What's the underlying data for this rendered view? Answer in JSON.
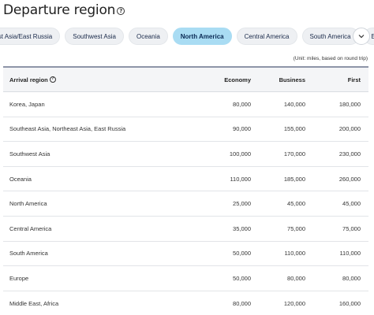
{
  "header": {
    "title": "Departure region",
    "help_icon": "question-circle-icon"
  },
  "tabs": [
    {
      "label": "East Asia/East Russia",
      "active": false
    },
    {
      "label": "Southwest Asia",
      "active": false
    },
    {
      "label": "Oceania",
      "active": false
    },
    {
      "label": "North America",
      "active": true
    },
    {
      "label": "Central America",
      "active": false
    },
    {
      "label": "South America",
      "active": false
    },
    {
      "label": "Europe",
      "active": false
    }
  ],
  "tabs_next_icon": "chevron-down-icon",
  "unit_note": "(Unit: miles, based on round trip)",
  "table": {
    "headers": {
      "region": "Arrival region",
      "economy": "Economy",
      "business": "Business",
      "first": "First"
    },
    "rows": [
      {
        "region": "Korea, Japan",
        "economy": "80,000",
        "business": "140,000",
        "first": "180,000"
      },
      {
        "region": "Southeast Asia, Northeast Asia, East Russia",
        "economy": "90,000",
        "business": "155,000",
        "first": "200,000"
      },
      {
        "region": "Southwest Asia",
        "economy": "100,000",
        "business": "170,000",
        "first": "230,000"
      },
      {
        "region": "Oceania",
        "economy": "110,000",
        "business": "185,000",
        "first": "260,000"
      },
      {
        "region": "North America",
        "economy": "25,000",
        "business": "45,000",
        "first": "45,000"
      },
      {
        "region": "Central America",
        "economy": "35,000",
        "business": "75,000",
        "first": "75,000"
      },
      {
        "region": "South America",
        "economy": "50,000",
        "business": "110,000",
        "first": "110,000"
      },
      {
        "region": "Europe",
        "economy": "50,000",
        "business": "80,000",
        "first": "80,000"
      },
      {
        "region": "Middle East, Africa",
        "economy": "80,000",
        "business": "120,000",
        "first": "160,000"
      }
    ]
  },
  "colors": {
    "active_tab": "#a9dcf3",
    "tab": "#eef0f3",
    "header_bg": "#f4f5f7",
    "header_border": "#8e95a8"
  }
}
